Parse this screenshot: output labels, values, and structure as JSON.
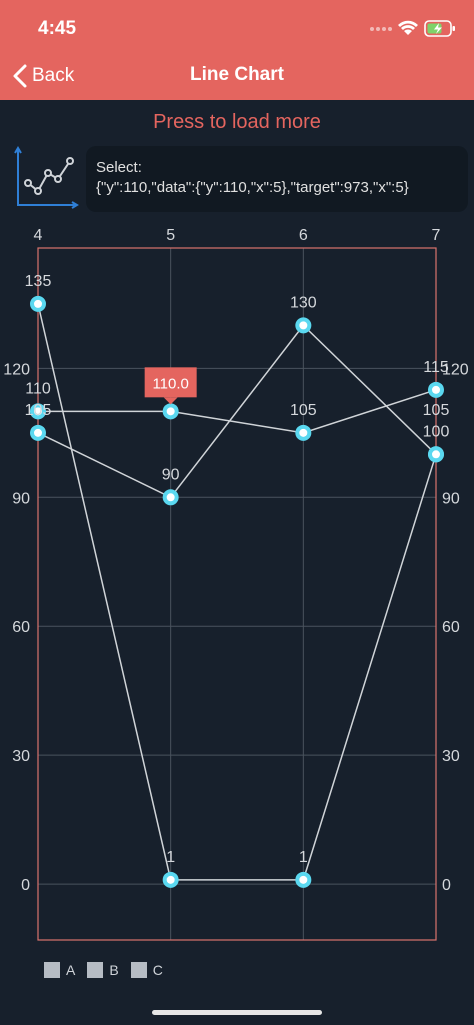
{
  "status_bar": {
    "time": "4:45"
  },
  "nav": {
    "back_label": "Back",
    "title": "Line Chart"
  },
  "actions": {
    "load_more": "Press to load more"
  },
  "selection": {
    "line1": "Select:",
    "line2": "{\"y\":110,\"data\":{\"y\":110,\"x\":5},\"target\":973,\"x\":5}"
  },
  "colors": {
    "header": "#e4655f",
    "background": "#17202c",
    "line": "#d0d4d8",
    "point_fill": "#5ad8f0",
    "point_center": "#ffffff",
    "border": "#d9736d",
    "grid": "#4a535e",
    "marker": "#e4655f"
  },
  "chart_data": {
    "type": "line",
    "x_ticks": [
      4,
      5,
      6,
      7
    ],
    "y_ticks": [
      0,
      30,
      60,
      90,
      120
    ],
    "xlim": [
      4,
      7
    ],
    "ylim": [
      -13,
      148
    ],
    "series": [
      {
        "name": "A",
        "x": [
          4,
          5,
          6,
          7
        ],
        "y": [
          135,
          1,
          1,
          100
        ]
      },
      {
        "name": "B",
        "x": [
          4,
          5,
          6,
          7
        ],
        "y": [
          105,
          90,
          130,
          100
        ]
      },
      {
        "name": "C",
        "x": [
          4,
          5,
          6,
          7
        ],
        "y": [
          110,
          110,
          105,
          115
        ]
      }
    ],
    "point_labels": [
      {
        "x": 4,
        "y": 135,
        "text": "135"
      },
      {
        "x": 4,
        "y": 110,
        "text": "110"
      },
      {
        "x": 4,
        "y": 105,
        "text": "105"
      },
      {
        "x": 5,
        "y": 90,
        "text": "90"
      },
      {
        "x": 5,
        "y": 1,
        "text": "1"
      },
      {
        "x": 6,
        "y": 130,
        "text": "130"
      },
      {
        "x": 6,
        "y": 105,
        "text": "105"
      },
      {
        "x": 6,
        "y": 1,
        "text": "1"
      },
      {
        "x": 7,
        "y": 115,
        "text": "115"
      },
      {
        "x": 7,
        "y": 105,
        "text": "105"
      },
      {
        "x": 7,
        "y": 100,
        "text": "100"
      }
    ],
    "marker": {
      "x": 5,
      "y": 110,
      "text": "110.0"
    },
    "legend": [
      {
        "label": "A",
        "color": "#b6bcc4"
      },
      {
        "label": "B",
        "color": "#b6bcc4"
      },
      {
        "label": "C",
        "color": "#b6bcc4"
      }
    ]
  }
}
